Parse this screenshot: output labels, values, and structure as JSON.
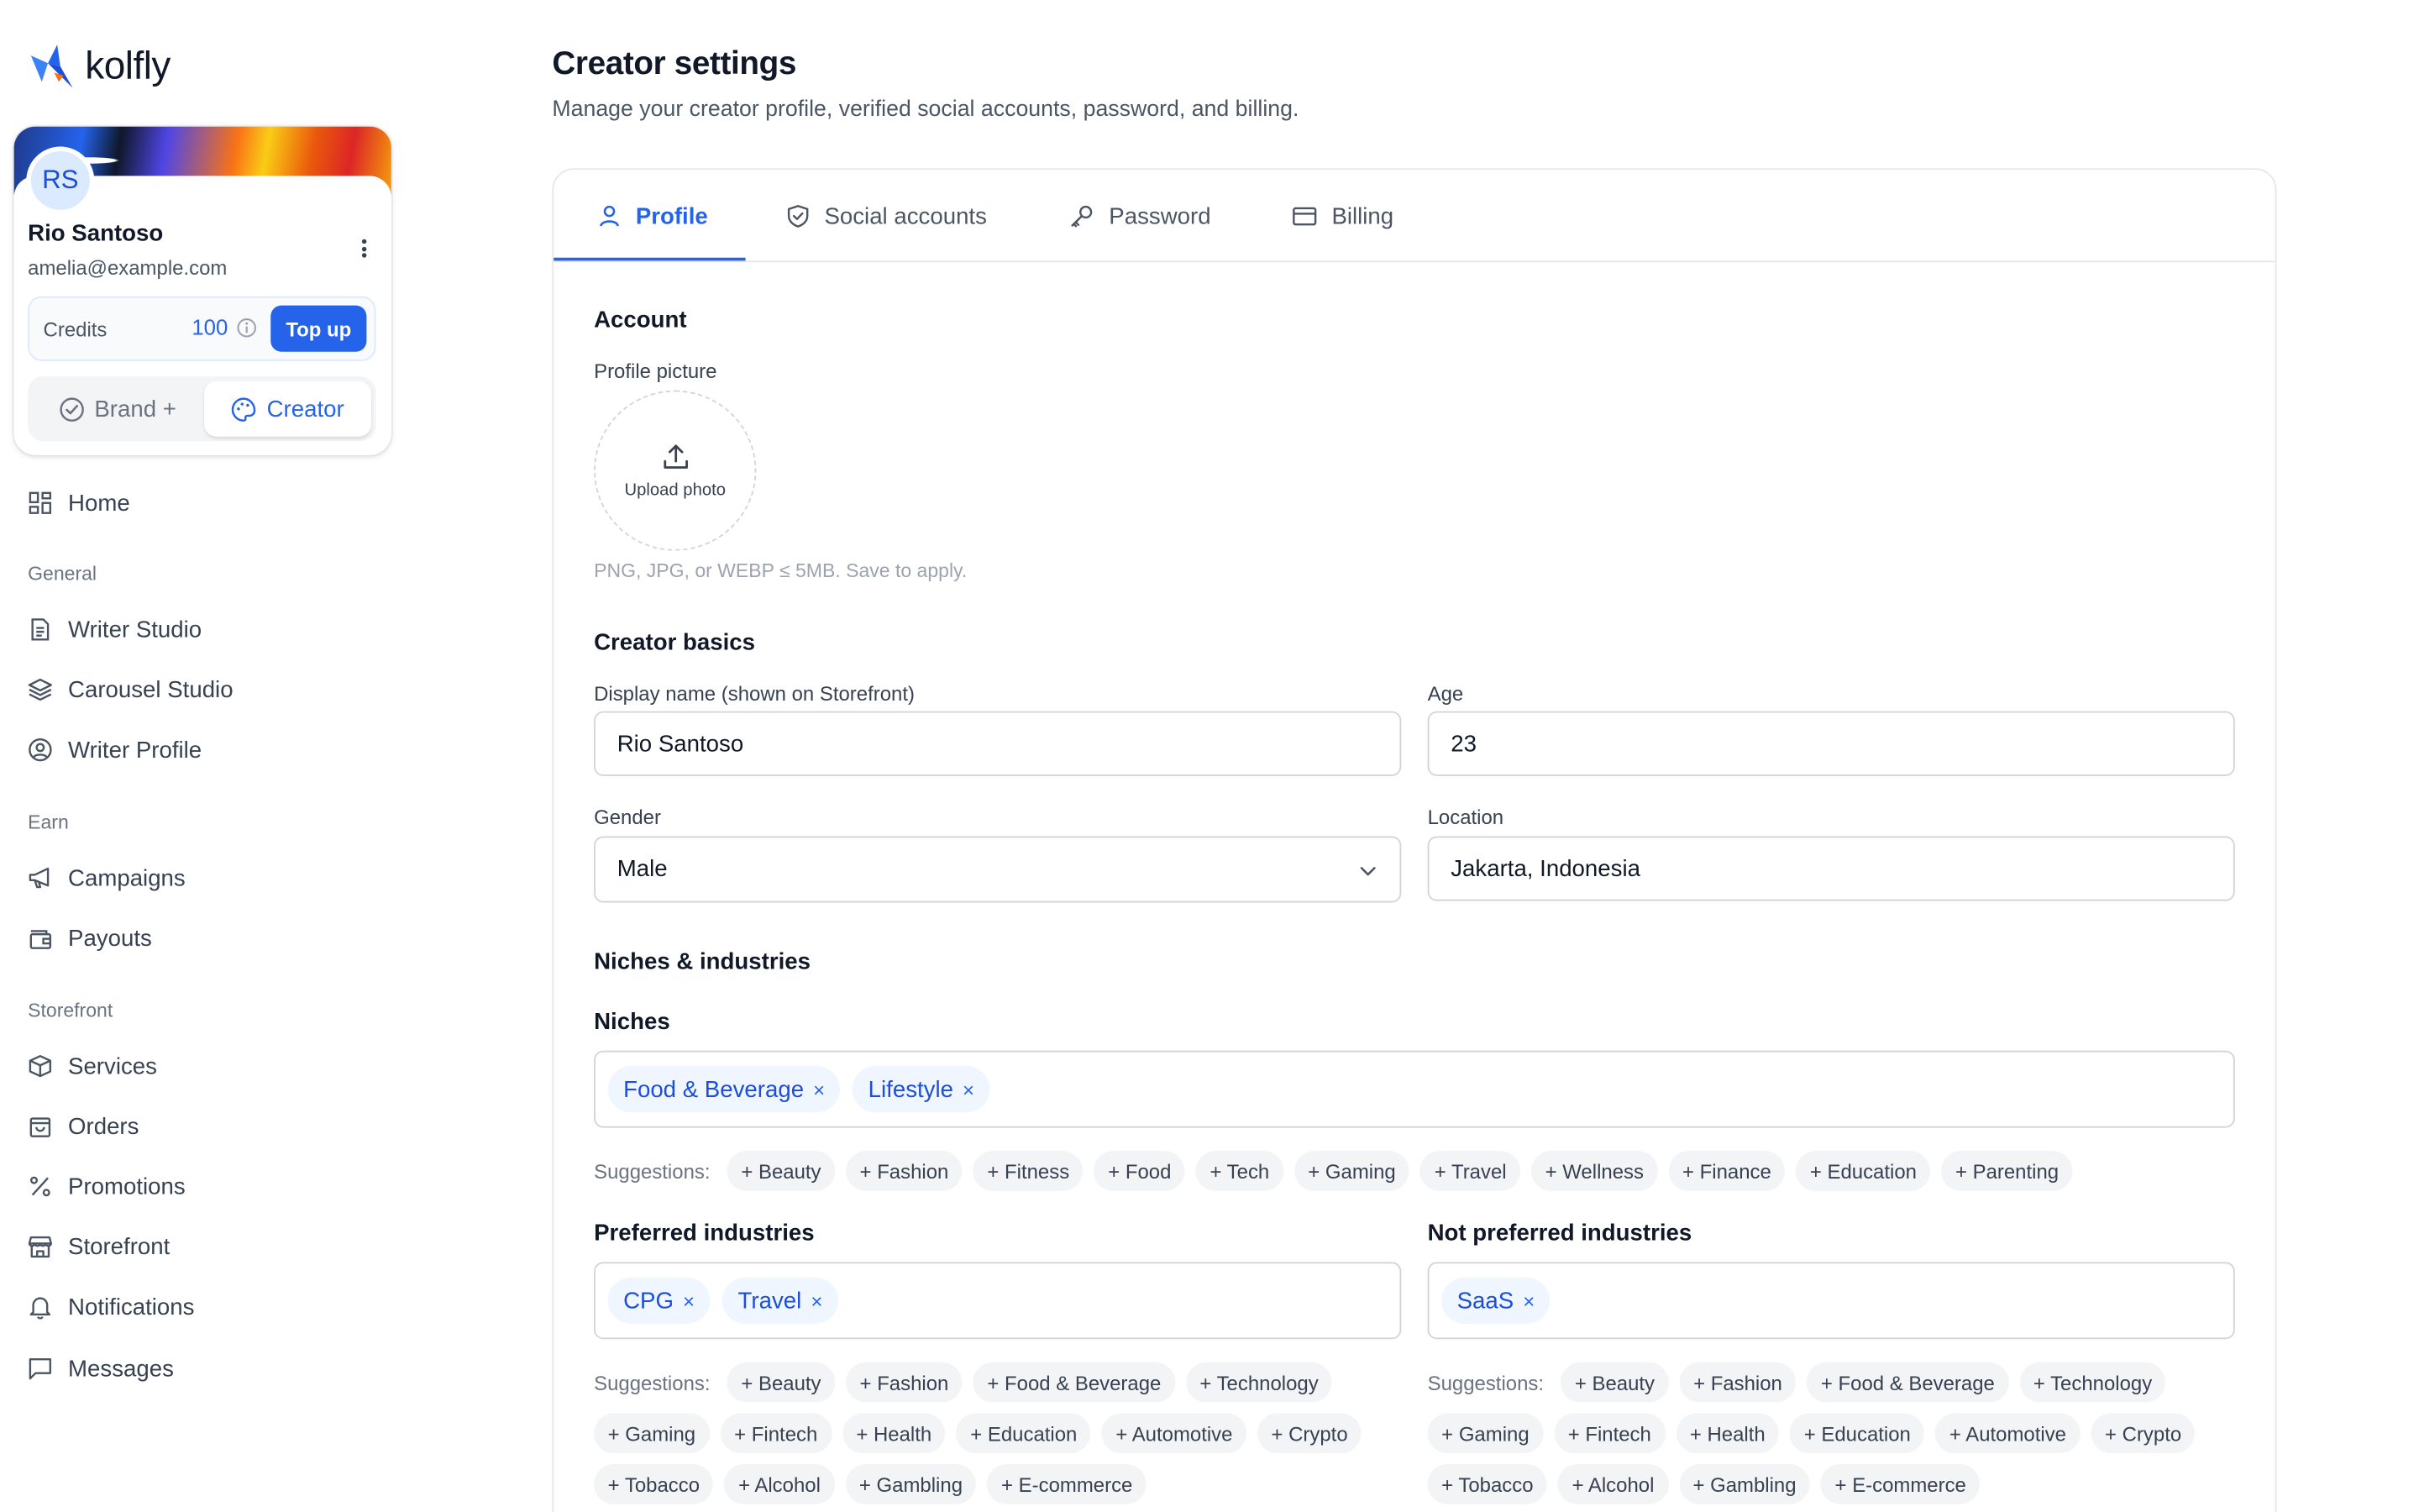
{
  "brand": {
    "name": "kolfly",
    "accent": "#2563eb"
  },
  "user": {
    "initials": "RS",
    "name": "Rio Santoso",
    "email": "amelia@example.com",
    "credits_label": "Credits",
    "credits_value": "100",
    "topup_label": "Top up",
    "mode_brand_label": "Brand +",
    "mode_creator_label": "Creator"
  },
  "nav": {
    "home": "Home",
    "sections": [
      {
        "title": "General",
        "items": [
          "Writer Studio",
          "Carousel Studio",
          "Writer Profile"
        ]
      },
      {
        "title": "Earn",
        "items": [
          "Campaigns",
          "Payouts"
        ]
      },
      {
        "title": "Storefront",
        "items": [
          "Services",
          "Orders",
          "Promotions",
          "Storefront",
          "Notifications",
          "Messages"
        ]
      }
    ]
  },
  "page": {
    "title": "Creator settings",
    "subtitle": "Manage your creator profile, verified social accounts, password, and billing."
  },
  "tabs": [
    "Profile",
    "Social accounts",
    "Password",
    "Billing"
  ],
  "account": {
    "heading": "Account",
    "picture_label": "Profile picture",
    "upload_label": "Upload photo",
    "hint": "PNG, JPG, or WEBP ≤ 5MB. Save to apply."
  },
  "basics": {
    "heading": "Creator basics",
    "display_name_label": "Display name (shown on Storefront)",
    "display_name_value": "Rio Santoso",
    "age_label": "Age",
    "age_value": "23",
    "gender_label": "Gender",
    "gender_value": "Male",
    "location_label": "Location",
    "location_value": "Jakarta, Indonesia"
  },
  "niches": {
    "heading": "Niches & industries",
    "niches_label": "Niches",
    "niches_selected": [
      "Food & Beverage",
      "Lifestyle"
    ],
    "suggestions_label": "Suggestions:",
    "niche_suggestions": [
      "+ Beauty",
      "+ Fashion",
      "+ Fitness",
      "+ Food",
      "+ Tech",
      "+ Gaming",
      "+ Travel",
      "+ Wellness",
      "+ Finance",
      "+ Education",
      "+ Parenting"
    ],
    "preferred_label": "Preferred industries",
    "preferred_selected": [
      "CPG",
      "Travel"
    ],
    "preferred_suggestions": [
      "+ Beauty",
      "+ Fashion",
      "+ Food & Beverage",
      "+ Technology",
      "+ Gaming",
      "+ Fintech",
      "+ Health",
      "+ Education",
      "+ Automotive",
      "+ Crypto",
      "+ Tobacco",
      "+ Alcohol",
      "+ Gambling",
      "+ E-commerce"
    ],
    "not_preferred_label": "Not preferred industries",
    "not_preferred_selected": [
      "SaaS"
    ],
    "not_preferred_suggestions": [
      "+ Beauty",
      "+ Fashion",
      "+ Food & Beverage",
      "+ Technology",
      "+ Gaming",
      "+ Fintech",
      "+ Health",
      "+ Education",
      "+ Automotive",
      "+ Crypto",
      "+ Tobacco",
      "+ Alcohol",
      "+ Gambling",
      "+ E-commerce"
    ]
  }
}
